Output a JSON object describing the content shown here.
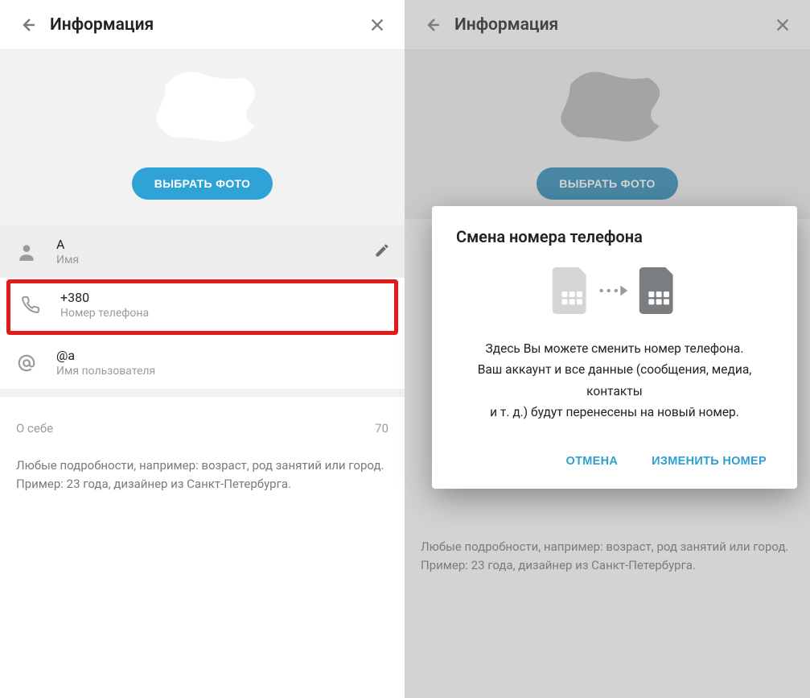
{
  "left": {
    "header": {
      "title": "Информация"
    },
    "choose_photo": "ВЫБРАТЬ ФОТО",
    "name": {
      "value": "A",
      "label": "Имя"
    },
    "phone": {
      "value": "+380",
      "label": "Номер телефона"
    },
    "username": {
      "value": "@a",
      "label": "Имя пользователя"
    },
    "about": {
      "label": "О себе",
      "counter": "70",
      "hint1": "Любые подробности, например: возраст, род занятий или город.",
      "hint2": "Пример: 23 года, дизайнер из Санкт-Петербурга."
    }
  },
  "right": {
    "header": {
      "title": "Информация"
    },
    "choose_photo": "ВЫБРАТЬ ФОТО",
    "dialog": {
      "title": "Смена номера телефона",
      "line1": "Здесь Вы можете сменить номер телефона.",
      "line2": "Ваш аккаунт и все данные (сообщения, медиа, контакты",
      "line3": "и т. д.) будут перенесены на новый номер.",
      "cancel": "ОТМЕНА",
      "confirm": "ИЗМЕНИТЬ НОМЕР"
    },
    "about": {
      "hint1": "Любые подробности, например: возраст, род занятий или город.",
      "hint2": "Пример: 23 года, дизайнер из Санкт-Петербурга."
    }
  }
}
